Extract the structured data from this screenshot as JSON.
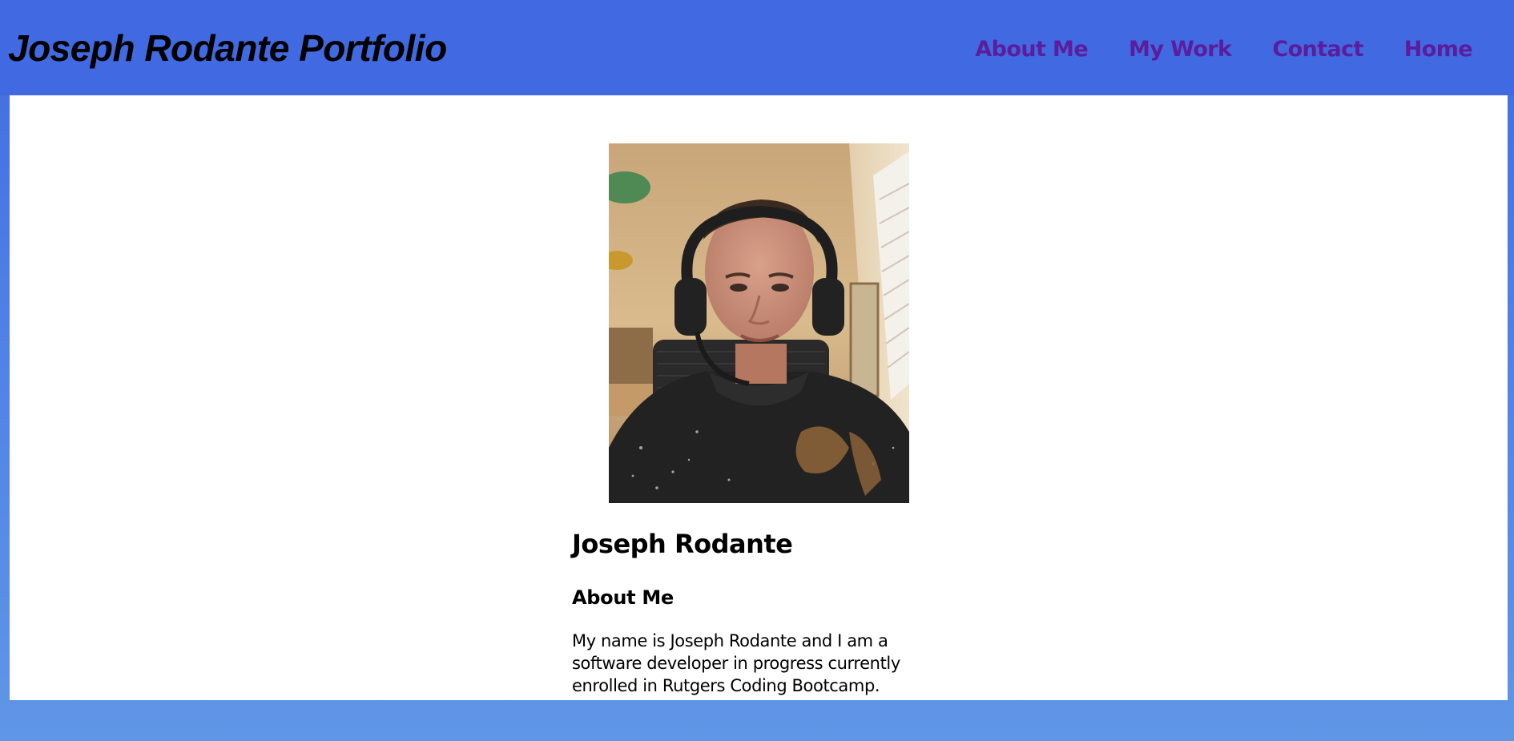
{
  "header": {
    "site_title": "Joseph Rodante Portfolio",
    "nav": [
      {
        "label": "About Me"
      },
      {
        "label": "My Work"
      },
      {
        "label": "Contact"
      },
      {
        "label": "Home"
      }
    ]
  },
  "profile": {
    "photo_alt": "Joseph Rodante",
    "name": "Joseph Rodante",
    "about_heading": "About Me",
    "about_text": "My name is Joseph Rodante and I am a software developer in progress currently enrolled in Rutgers Coding Bootcamp."
  },
  "colors": {
    "header_bg": "#4169e1",
    "nav_link": "#5b1d9c",
    "content_bg": "#ffffff"
  }
}
